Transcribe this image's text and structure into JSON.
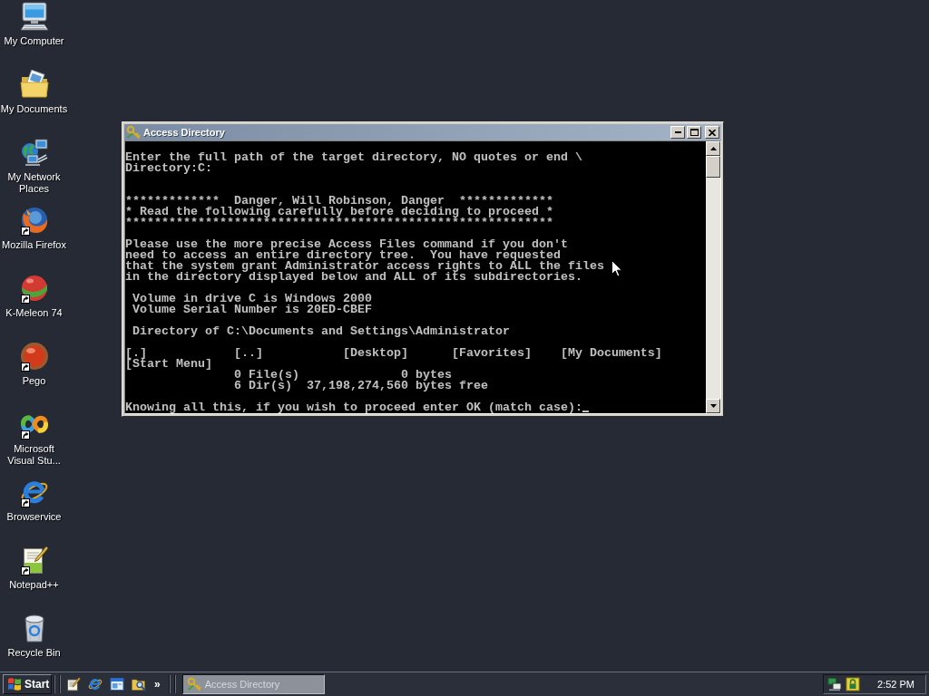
{
  "desktop_icons": [
    {
      "label": "My Computer",
      "kind": "computer",
      "shortcut": false
    },
    {
      "label": "My Documents",
      "kind": "folder",
      "shortcut": false
    },
    {
      "label": "My Network Places",
      "kind": "network",
      "shortcut": false
    },
    {
      "label": "Mozilla Firefox",
      "kind": "swirl_globe",
      "shortcut": true
    },
    {
      "label": "K-Meleon 74",
      "kind": "ball",
      "shortcut": true
    },
    {
      "label": "Pego",
      "kind": "sphere",
      "shortcut": true
    },
    {
      "label": "Microsoft Visual Stu...",
      "kind": "infinity",
      "shortcut": true
    },
    {
      "label": "Browservice",
      "kind": "e_logo",
      "shortcut": true
    },
    {
      "label": "Notepad++",
      "kind": "notepad",
      "shortcut": true
    },
    {
      "label": "Recycle Bin",
      "kind": "bin",
      "shortcut": false
    }
  ],
  "window": {
    "title": "Access Directory",
    "console": {
      "blocks": [
        [
          "Enter the full path of the target directory, NO quotes or end \\",
          "Directory:C:"
        ],
        [
          "*************  Danger, Will Robinson, Danger  *************",
          "* Read the following carefully before deciding to proceed *",
          "***********************************************************"
        ],
        [
          "Please use the more precise Access Files command if you don't",
          "need to access an entire directory tree.  You have requested",
          "that the system grant Administrator access rights to ALL the files",
          "in the directory displayed below and ALL of its subdirectories."
        ],
        [
          " Volume in drive C is Windows 2000",
          " Volume Serial Number is 20ED-CBEF"
        ],
        [
          " Directory of C:\\Documents and Settings\\Administrator"
        ],
        [
          "[.]            [..]           [Desktop]      [Favorites]    [My Documents]",
          "[Start Menu]",
          "               0 File(s)              0 bytes",
          "               6 Dir(s)  37,198,274,560 bytes free"
        ]
      ],
      "prompt": "Knowing all this, if you wish to proceed enter OK (match case):"
    }
  },
  "taskbar": {
    "start": "Start",
    "quick_launch": [
      {
        "kind": "notepad_pencil"
      },
      {
        "kind": "e_logo"
      },
      {
        "kind": "app_window"
      },
      {
        "kind": "folder_search"
      }
    ],
    "overflow": "»",
    "tasks": [
      {
        "title": "Access Directory",
        "selected": true
      }
    ],
    "tray": [
      {
        "kind": "network_tray"
      },
      {
        "kind": "padlock"
      }
    ],
    "clock": "2:52 PM"
  }
}
